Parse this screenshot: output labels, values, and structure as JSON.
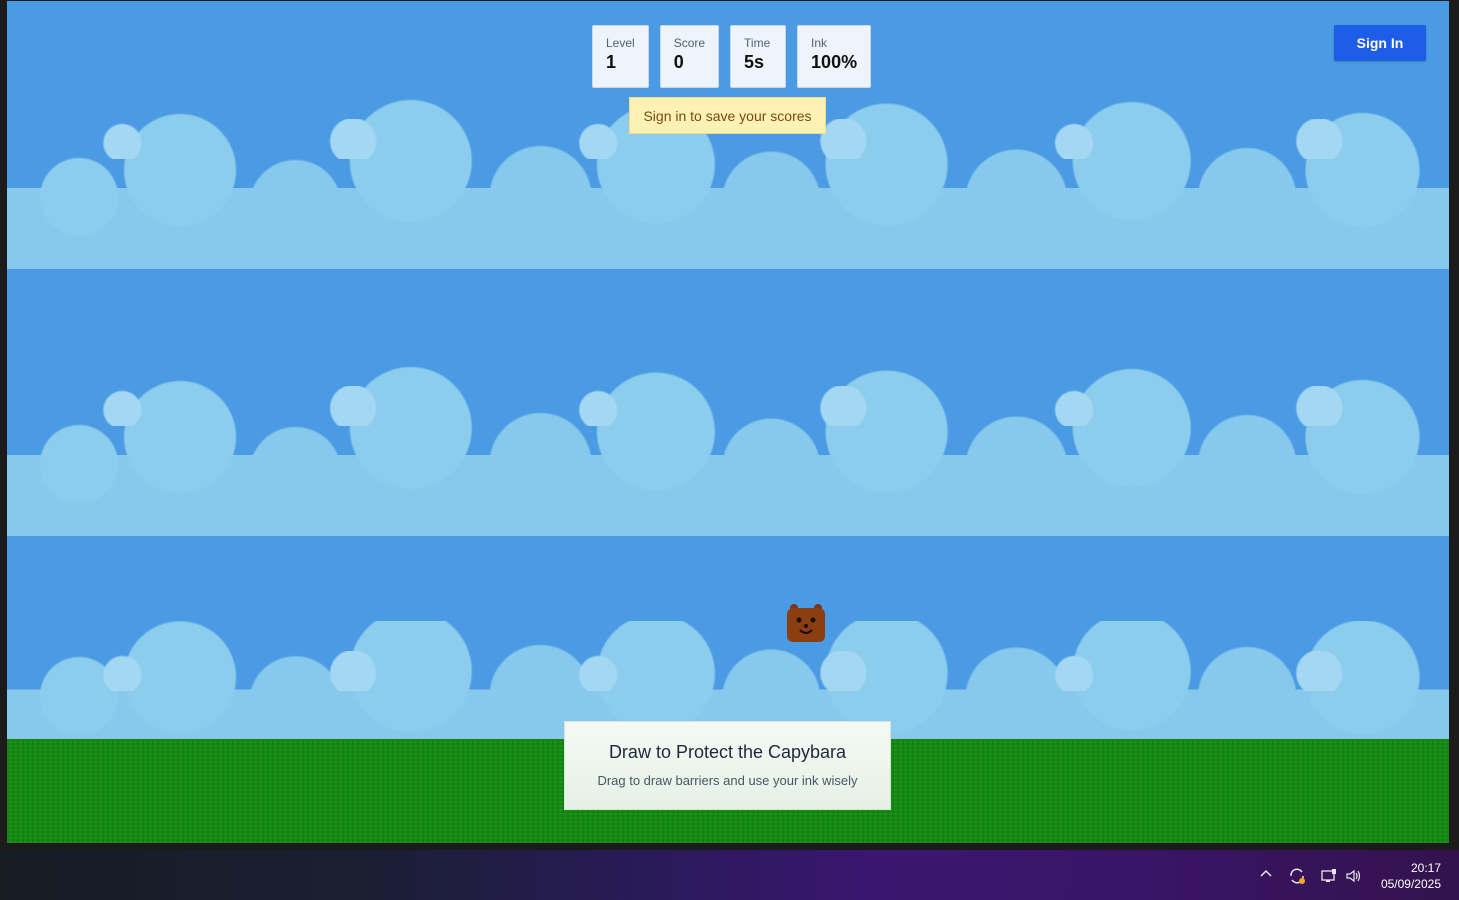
{
  "hud": {
    "level_label": "Level",
    "level_value": "1",
    "score_label": "Score",
    "score_value": "0",
    "time_label": "Time",
    "time_value": "5s",
    "ink_label": "Ink",
    "ink_value": "100%"
  },
  "banner": {
    "text": "Sign in to save your scores"
  },
  "auth": {
    "sign_in_label": "Sign In"
  },
  "instructions": {
    "title": "Draw to Protect the Capybara",
    "text": "Drag to draw barriers and use your ink wisely"
  },
  "taskbar": {
    "time": "20:17",
    "date": "05/09/2025",
    "icons": [
      "chevron-up-icon",
      "sync-icon",
      "network-icon",
      "volume-icon"
    ]
  },
  "colors": {
    "sky": "#4a9be3",
    "cloud": "#8ccdee",
    "grass": "#118a0f",
    "sign_in_button": "#1e5de8",
    "banner_bg": "#fdf1b4",
    "capybara": "#8b3e10"
  }
}
